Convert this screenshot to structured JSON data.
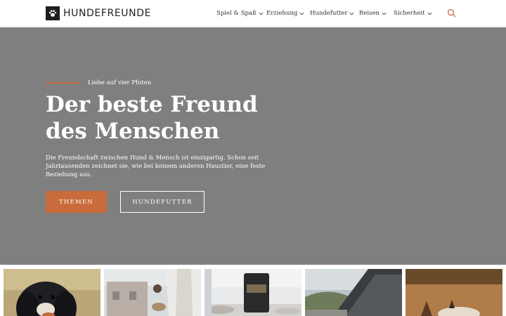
{
  "header": {
    "logo_text": "HUNDEFREUNDE",
    "logo_icon": "paw-icon",
    "nav": [
      {
        "label": "Spiel & Spaß",
        "has_dropdown": true
      },
      {
        "label": "Erziehung",
        "has_dropdown": true
      },
      {
        "label": "Hundefutter",
        "has_dropdown": true
      },
      {
        "label": "Reisen",
        "has_dropdown": true
      },
      {
        "label": "Sicherheit",
        "has_dropdown": true
      }
    ],
    "search_icon": "search-icon"
  },
  "hero": {
    "eyebrow": "Liebe auf vier Pfoten",
    "title_line1": "Der beste Freund",
    "title_line2": "des Menschen",
    "text": "Die Freundschaft zwischen Hund & Mensch ist einzigartig. Schon seit Jahrtausenden zeichnet sie, wie bei keinem anderen Haustier, eine feste Beziehung aus.",
    "primary_button": "THEMEN",
    "secondary_button": "HUNDEFUTTER"
  },
  "colors": {
    "accent": "#c96b3a",
    "hero_background": "#7f7f7f",
    "text_dark": "#333333",
    "white": "#ffffff"
  },
  "thumbnails": [
    {
      "subject": "spaniel-dog"
    },
    {
      "subject": "person-walking-dog"
    },
    {
      "subject": "dog-food-bag"
    },
    {
      "subject": "car-travel"
    },
    {
      "subject": "dog-outdoors"
    }
  ]
}
